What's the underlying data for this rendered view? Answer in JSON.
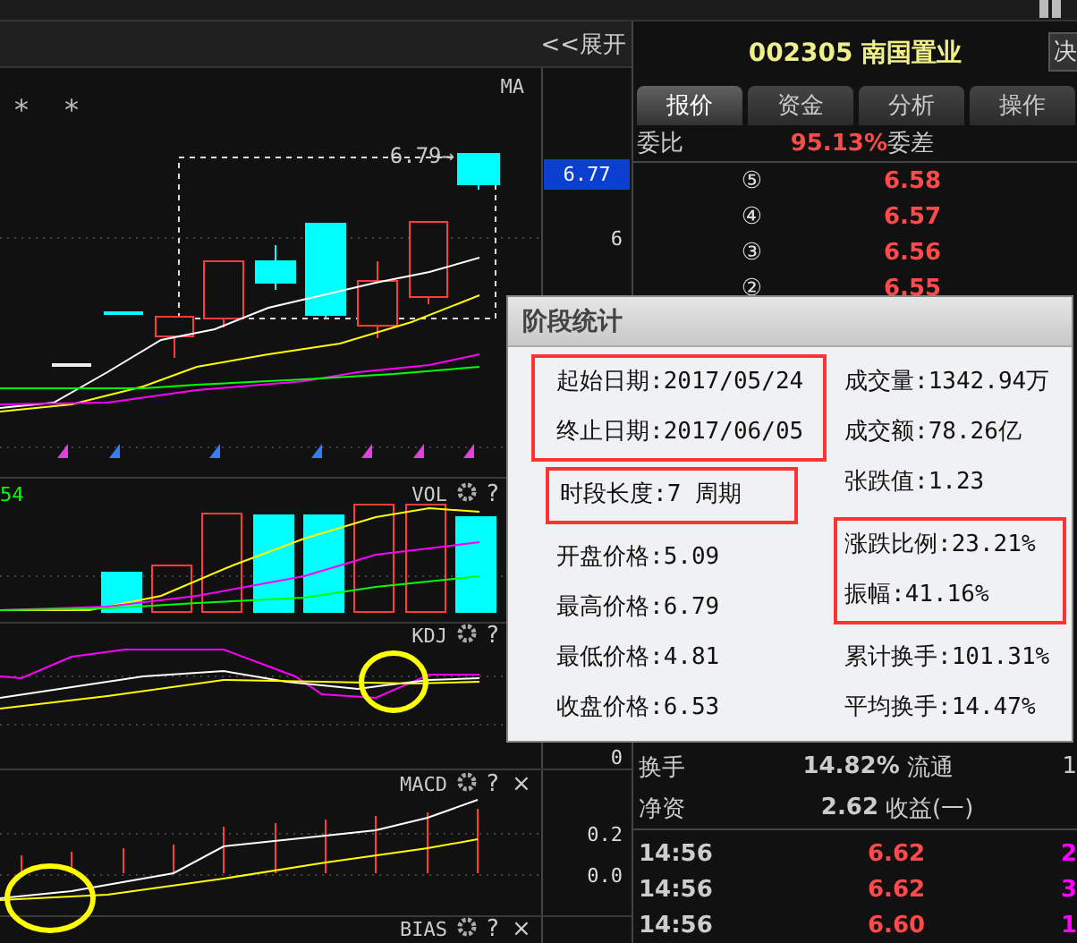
{
  "chart_toolbar": {
    "expand": "<<展开"
  },
  "chart": {
    "markers": [
      "*",
      "*"
    ],
    "high_label": "6.79→",
    "panels": [
      {
        "label": "MA"
      },
      {
        "label": "VOL",
        "value": "54",
        "help": "?"
      },
      {
        "label": "KDJ",
        "help": "?"
      },
      {
        "label": "MACD",
        "help": "?",
        "close": "×"
      },
      {
        "label": "BIAS",
        "help": "?",
        "close": "×"
      }
    ]
  },
  "price_axis": {
    "current": "6.77",
    "ticks": [
      "6",
      "0",
      "0.2",
      "0.0"
    ]
  },
  "stock": {
    "code": "002305",
    "name": "南国置业",
    "side_button": "决"
  },
  "tabs": [
    {
      "label": "报价",
      "selected": true
    },
    {
      "label": "资金",
      "selected": false
    },
    {
      "label": "分析",
      "selected": false
    },
    {
      "label": "操作",
      "selected": false
    }
  ],
  "order_ratio": {
    "label": "委比",
    "value": "95.13%",
    "label2": "委差"
  },
  "asks": [
    {
      "level": "⑤",
      "price": "6.58"
    },
    {
      "level": "④",
      "price": "6.57"
    },
    {
      "level": "③",
      "price": "6.56"
    },
    {
      "level": "②",
      "price": "6.55"
    }
  ],
  "info": [
    {
      "label": "换手",
      "value": "14.82%",
      "label2": "流通",
      "value2": "1"
    },
    {
      "label": "净资",
      "value": "2.62",
      "label2": "收益(一)"
    }
  ],
  "trades": [
    {
      "time": "14:56",
      "price": "6.62",
      "volume": "2"
    },
    {
      "time": "14:56",
      "price": "6.62",
      "volume": "3"
    },
    {
      "time": "14:56",
      "price": "6.60",
      "volume": "1"
    }
  ],
  "popup": {
    "title": "阶段统计",
    "columns": [
      [
        {
          "highlighted": true,
          "items": [
            "起始日期:2017/05/24",
            "终止日期:2017/06/05"
          ]
        },
        {
          "highlighted": true,
          "items": [
            "时段长度:7 周期"
          ]
        },
        {
          "highlighted": false,
          "items": [
            "开盘价格:5.09",
            "最高价格:6.79",
            "最低价格:4.81",
            "收盘价格:6.53"
          ]
        }
      ],
      [
        {
          "highlighted": false,
          "items": [
            "成交量:1342.94万",
            "成交额:78.26亿",
            "张跌值:1.23"
          ]
        },
        {
          "highlighted": true,
          "items": [
            "涨跌比例:23.21%",
            "振幅:41.16%"
          ]
        },
        {
          "highlighted": false,
          "items": [
            "累计换手:101.31%",
            "平均换手:14.47%"
          ]
        }
      ]
    ]
  }
}
